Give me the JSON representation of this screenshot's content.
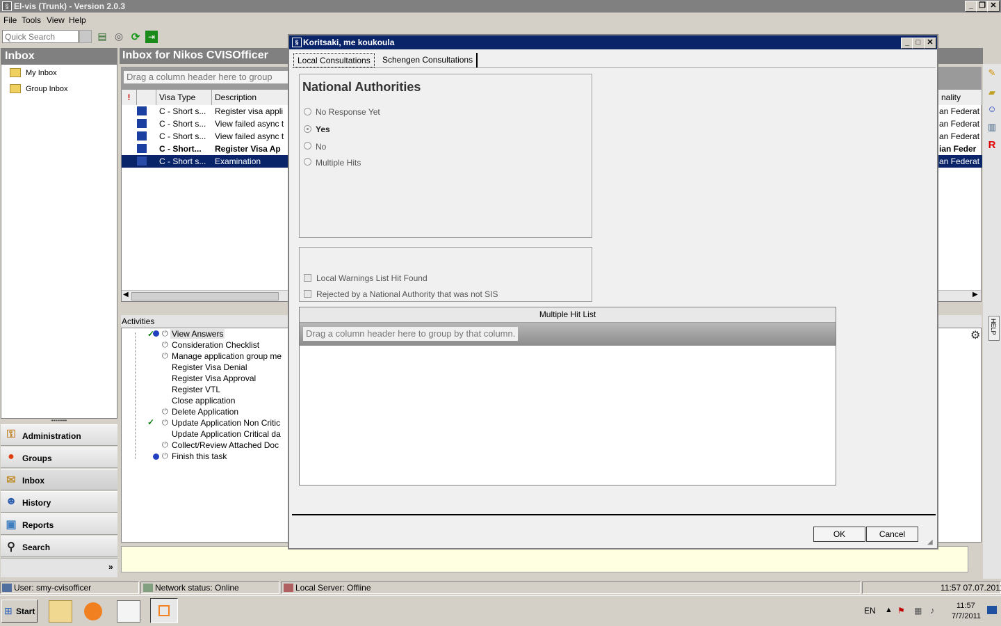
{
  "window": {
    "title": "El-vis (Trunk) - Version 2.0.3"
  },
  "menu": [
    "File",
    "Tools",
    "View",
    "Help"
  ],
  "toolbar": {
    "search_placeholder": "Quick Search"
  },
  "sidebar": {
    "title": "Inbox",
    "items": [
      {
        "label": "My Inbox"
      },
      {
        "label": "Group Inbox"
      }
    ],
    "nav": [
      {
        "label": "Administration"
      },
      {
        "label": "Groups"
      },
      {
        "label": "Inbox"
      },
      {
        "label": "History"
      },
      {
        "label": "Reports"
      },
      {
        "label": "Search"
      }
    ],
    "more": "»"
  },
  "inbox": {
    "title": "Inbox for Nikos CVISOfficer",
    "group_hint": "Drag a column header here to group",
    "columns": {
      "priority": "!",
      "visa_type": "Visa Type",
      "description": "Description",
      "nationality": "nality"
    },
    "rows": [
      {
        "visa_type": "C - Short s...",
        "description": "Register visa appli",
        "nationality": "an Federat"
      },
      {
        "visa_type": "C - Short s...",
        "description": "View failed async t",
        "nationality": "an Federat"
      },
      {
        "visa_type": "C - Short s...",
        "description": "View failed async t",
        "nationality": "an Federat"
      },
      {
        "visa_type": "C - Short...",
        "description": "Register Visa Ap",
        "nationality": "ian Feder"
      },
      {
        "visa_type": "C - Short s...",
        "description": "Examination",
        "nationality": "an Federat"
      }
    ]
  },
  "activities": {
    "title": "Activities",
    "items": [
      "View Answers",
      "Consideration Checklist",
      "Manage application group me",
      "Register Visa Denial",
      "Register Visa Approval",
      "Register VTL",
      "Close application",
      "Delete Application",
      "Update Application Non Critic",
      "Update Application Critical da",
      "Collect/Review Attached Doc",
      "Finish this task"
    ]
  },
  "dialog": {
    "title": "Koritsaki, me koukoula",
    "tabs": [
      "Local Consultations",
      "Schengen Consultations"
    ],
    "national_authorities": {
      "heading": "National Authorities",
      "options": [
        "No Response Yet",
        "Yes",
        "No",
        "Multiple Hits"
      ],
      "selected": "Yes"
    },
    "checks": [
      "Local Warnings List Hit Found",
      "Rejected by a National Authority that was not SIS"
    ],
    "hit_list": {
      "title": "Multiple Hit List",
      "group_hint": "Drag a column header here to group by that column."
    },
    "ok": "OK",
    "cancel": "Cancel"
  },
  "side_panel": {
    "help": "HELP"
  },
  "status": {
    "user": "User: smy-cvisofficer",
    "network": "Network status: Online",
    "server": "Local Server:  Offline",
    "datetime": "11:57 07.07.2011"
  },
  "taskbar": {
    "start": "Start",
    "lang": "EN",
    "time": "11:57",
    "date": "7/7/2011"
  },
  "colors": {
    "selection": "#0a246a",
    "info_bar": "#ffffe1"
  }
}
